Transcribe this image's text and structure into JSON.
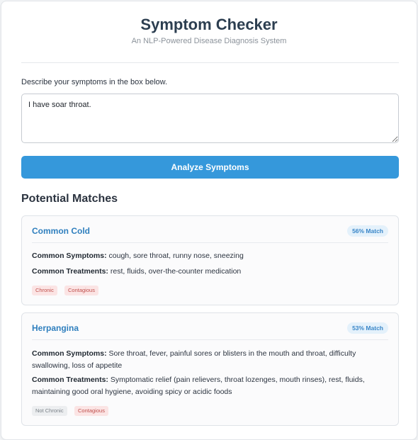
{
  "header": {
    "title": "Symptom Checker",
    "subtitle": "An NLP-Powered Disease Diagnosis System"
  },
  "input": {
    "prompt": "Describe your symptoms in the box below.",
    "value": "I have soar throat."
  },
  "analyze_button": {
    "label": "Analyze Symptoms"
  },
  "results": {
    "heading": "Potential Matches",
    "symptoms_label": "Common Symptoms:",
    "treatments_label": "Common Treatments:",
    "items": [
      {
        "name": "Common Cold",
        "match": "56% Match",
        "symptoms": "cough, sore throat, runny nose, sneezing",
        "treatments": "rest, fluids, over-the-counter medication",
        "tags": [
          "Chronic",
          "Contagious"
        ]
      },
      {
        "name": "Herpangina",
        "match": "53% Match",
        "symptoms": "Sore throat, fever, painful sores or blisters in the mouth and throat, difficulty swallowing, loss of appetite",
        "treatments": "Symptomatic relief (pain relievers, throat lozenges, mouth rinses), rest, fluids, maintaining good oral hygiene, avoiding spicy or acidic foods",
        "tags": [
          "Not Chronic",
          "Contagious"
        ]
      }
    ]
  },
  "colors": {
    "accent": "#3598db",
    "disease_name": "#2f7fbe",
    "tag_red_text": "#c0504d",
    "tag_grey_text": "#7b8188"
  }
}
